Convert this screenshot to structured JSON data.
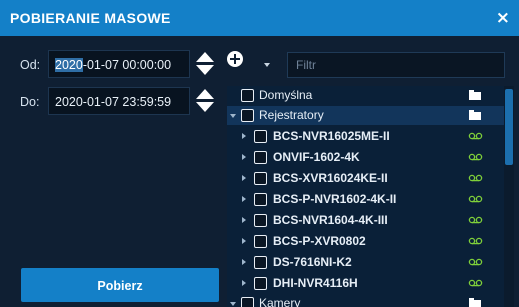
{
  "dialog": {
    "title": "POBIERANIE MASOWE",
    "close_glyph": "×"
  },
  "from": {
    "label": "Od:",
    "value_highlight": "2020",
    "value_rest": "-01-07 00:00:00"
  },
  "to": {
    "label": "Do:",
    "value": "2020-01-07 23:59:59"
  },
  "filter": {
    "placeholder": "Filtr",
    "value": ""
  },
  "tree": {
    "groups": [
      {
        "label": "Domyślna",
        "icon": "folder-icon"
      },
      {
        "label": "Rejestratory",
        "icon": "folder-icon",
        "expanded": true
      },
      {
        "label": "Kamery",
        "icon": "folder-icon",
        "expanded": true
      }
    ],
    "devices": [
      {
        "label": "BCS-NVR16025ME-II",
        "icon": "recording-icon"
      },
      {
        "label": "ONVIF-1602-4K",
        "icon": "recording-icon"
      },
      {
        "label": "BCS-XVR16024KE-II",
        "icon": "recording-icon"
      },
      {
        "label": "BCS-P-NVR1602-4K-II",
        "icon": "recording-icon"
      },
      {
        "label": "BCS-NVR1604-4K-III",
        "icon": "recording-icon"
      },
      {
        "label": "BCS-P-XVR0802",
        "icon": "recording-icon"
      },
      {
        "label": "DS-7616NI-K2",
        "icon": "recording-icon"
      },
      {
        "label": "DHI-NVR4116H",
        "icon": "recording-icon"
      }
    ]
  },
  "actions": {
    "fetch_label": "Pobierz"
  },
  "colors": {
    "accent": "#1480c8",
    "background": "#0f1f33",
    "tree_background": "#0a2038",
    "recording_icon": "#7fd03a"
  }
}
